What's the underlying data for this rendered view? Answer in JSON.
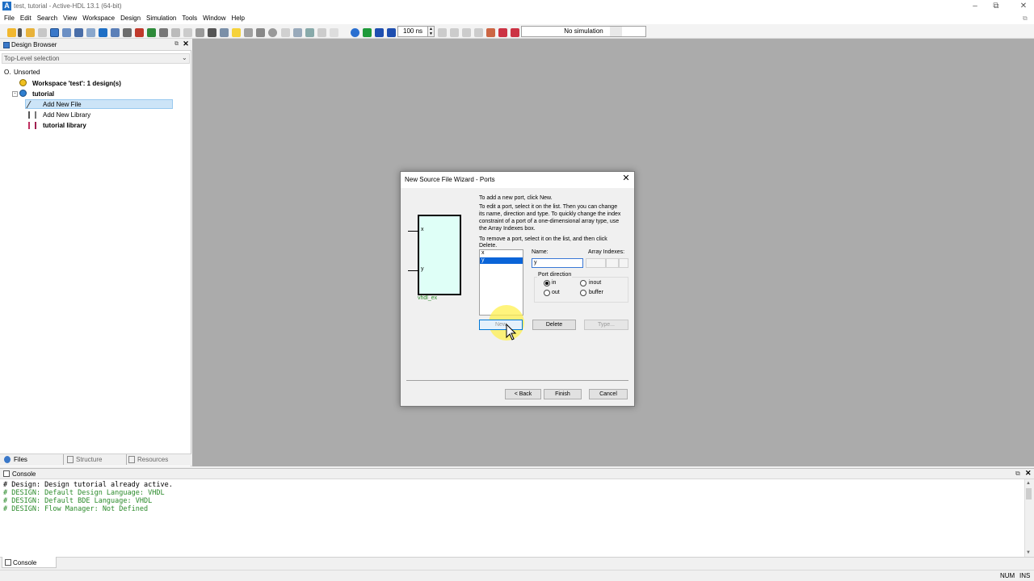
{
  "window": {
    "title": "test, tutorial - Active-HDL 13.1 (64-bit)",
    "app_icon": "A"
  },
  "menu": [
    "File",
    "Edit",
    "Search",
    "View",
    "Workspace",
    "Design",
    "Simulation",
    "Tools",
    "Window",
    "Help"
  ],
  "toolbar": {
    "sim_time": "100 ns",
    "sim_status": "No simulation"
  },
  "design_browser": {
    "title": "Design Browser",
    "top_level_selection": "Top-Level selection",
    "tree": [
      {
        "label": "Unsorted",
        "prefix": "O."
      },
      {
        "label": "Workspace 'test': 1 design(s)"
      },
      {
        "label": "tutorial"
      },
      {
        "label": "Add New File"
      },
      {
        "label": "Add New Library"
      },
      {
        "label": "tutorial library"
      }
    ],
    "tabs": [
      "Files",
      "Structure",
      "Resources"
    ]
  },
  "dialog": {
    "title": "New Source File Wizard - Ports",
    "instructions": {
      "add": "To add a new port, click New.",
      "edit": [
        "To edit a port, select it on the list. Then you can change",
        "its name, direction and type. To quickly change the index",
        "constraint of a port of a one-dimensional array type, use",
        "the Array Indexes box."
      ],
      "remove": [
        "To remove a port, select it on the list, and then click",
        "Delete."
      ]
    },
    "symbol": {
      "ports": [
        "x",
        "y"
      ],
      "name": "vhdl_ex"
    },
    "ports_list": [
      "x",
      "y"
    ],
    "name_label": "Name:",
    "name_value": "y",
    "array_indexes_label": "Array Indexes:",
    "port_direction_label": "Port direction",
    "directions": {
      "in": "in",
      "out": "out",
      "inout": "inout",
      "buffer": "buffer"
    },
    "selected_direction": "in",
    "buttons": {
      "new": "New",
      "delete": "Delete",
      "type": "Type...",
      "back": "< Back",
      "finish": "Finish",
      "cancel": "Cancel"
    }
  },
  "console": {
    "title": "Console",
    "lines": [
      "# Design: Design tutorial already active.",
      "# DESIGN: Default Design Language: VHDL",
      "# DESIGN: Default BDE Language: VHDL",
      "# DESIGN: Flow Manager: Not Defined"
    ],
    "tab": "Console"
  },
  "statusbar": {
    "num": "NUM",
    "ins": "INS"
  },
  "colors": {
    "console_green": "#2a8a2a",
    "selection_blue": "#0a64d8",
    "workspace_gray": "#ababab"
  }
}
